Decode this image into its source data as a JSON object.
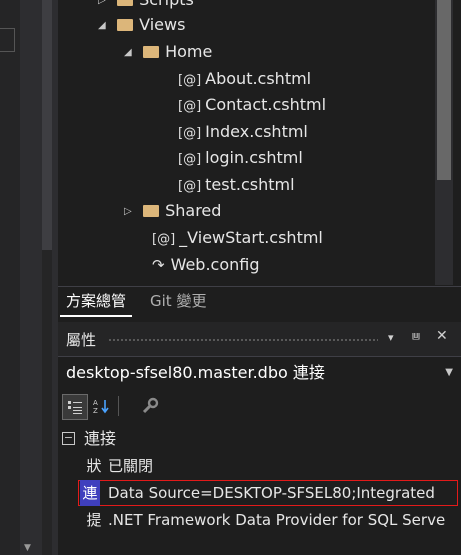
{
  "tree": [
    {
      "label": "Scripts",
      "type": "folder",
      "expanded": false
    },
    {
      "label": "Views",
      "type": "folder",
      "expanded": true
    },
    {
      "label": "Home",
      "type": "folder",
      "expanded": true
    },
    {
      "label": "About.cshtml",
      "type": "razor"
    },
    {
      "label": "Contact.cshtml",
      "type": "razor"
    },
    {
      "label": "Index.cshtml",
      "type": "razor"
    },
    {
      "label": "login.cshtml",
      "type": "razor"
    },
    {
      "label": "test.cshtml",
      "type": "razor"
    },
    {
      "label": "Shared",
      "type": "folder",
      "expanded": false
    },
    {
      "label": "_ViewStart.cshtml",
      "type": "razor"
    },
    {
      "label": "Web.config",
      "type": "config"
    }
  ],
  "icons": {
    "razor": "[@]",
    "config": "↷",
    "expanded": "◢",
    "collapsed": "▷"
  },
  "tabs": {
    "solution_explorer": "方案總管",
    "git_changes": "Git 變更"
  },
  "properties": {
    "title": "屬性",
    "object": "desktop-sfsel80.master.dbo  連接",
    "category_toggle": "⊟",
    "category": "連接",
    "rows": [
      {
        "key": "狀",
        "value": "已關閉"
      },
      {
        "key": "連",
        "value": "Data Source=DESKTOP-SFSEL80;Integrated"
      },
      {
        "key": "提",
        "value": ".NET Framework Data Provider for SQL Serve"
      }
    ]
  },
  "title_icons": {
    "dropdown": "▾",
    "pin": "⩏",
    "close": "✕"
  },
  "colors": {
    "selection_outline": "#e31a1a",
    "key_highlight": "#3f3fbe",
    "folder": "#dcb67a"
  }
}
